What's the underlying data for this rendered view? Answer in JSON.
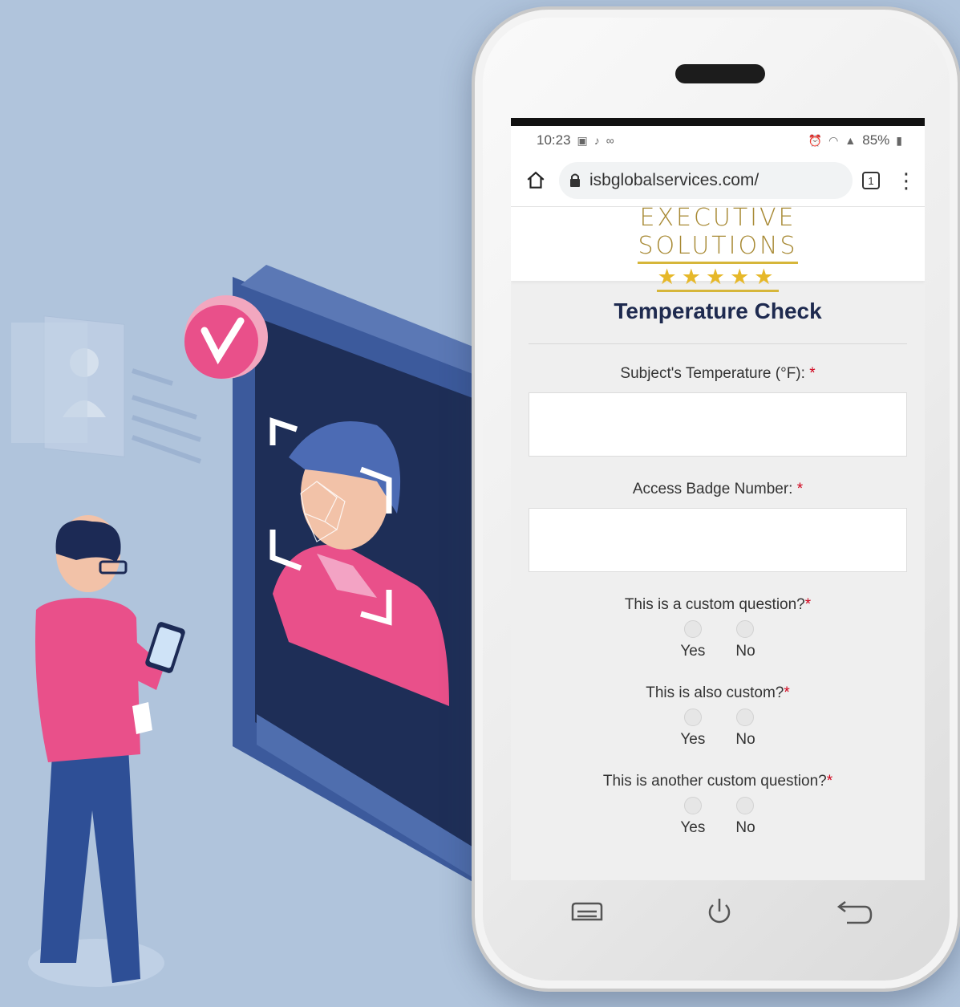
{
  "status_bar": {
    "time": "10:23",
    "left_icons": [
      "image-icon",
      "music-note-icon",
      "voicemail-icon"
    ],
    "battery": "85%",
    "right_icons": [
      "alarm-icon",
      "wifi-icon",
      "signal-icon",
      "battery-icon"
    ]
  },
  "browser": {
    "url": "isbglobalservices.com/",
    "tab_count": "1"
  },
  "logo": {
    "line1": "EXECUTIVE",
    "line2": "SOLUTIONS",
    "stars": "★★★★★"
  },
  "form": {
    "title": "Temperature Check",
    "fields": [
      {
        "label": "Subject's Temperature (°F):",
        "value": "",
        "required_mark": "*"
      },
      {
        "label": "Access Badge Number:",
        "value": "",
        "required_mark": "*"
      }
    ],
    "questions": [
      {
        "label": "This is a custom question?",
        "required_mark": "*",
        "options": [
          "Yes",
          "No"
        ]
      },
      {
        "label": "This is also custom?",
        "required_mark": "*",
        "options": [
          "Yes",
          "No"
        ]
      },
      {
        "label": "This is another custom question?",
        "required_mark": "*",
        "options": [
          "Yes",
          "No"
        ]
      }
    ]
  },
  "nav": [
    "menu-icon",
    "power-icon",
    "back-icon"
  ],
  "colors": {
    "background": "#b0c4dc",
    "title": "#1e2a4f",
    "logo_gold": "#a88a35",
    "required": "#d0021b",
    "figure_pink": "#e9508a",
    "device_blue": "#3c5a9c"
  }
}
